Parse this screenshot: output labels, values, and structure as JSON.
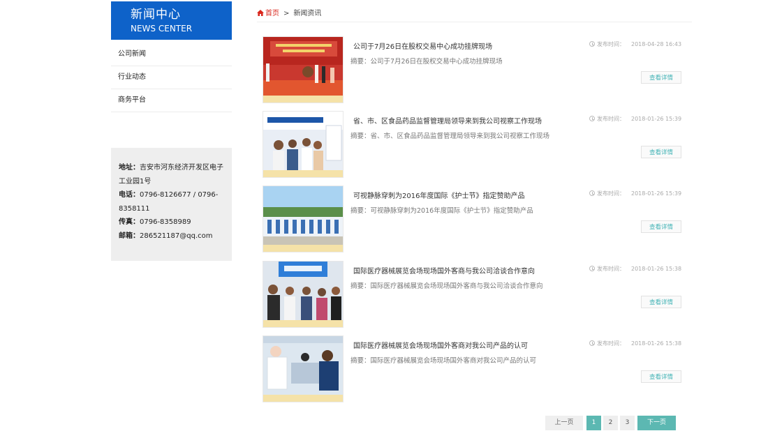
{
  "sidebar": {
    "title_cn": "新闻中心",
    "title_en": "NEWS CENTER",
    "nav": [
      "公司新闻",
      "行业动态",
      "商务平台"
    ],
    "contact": {
      "address_label": "地址：",
      "address": "吉安市河东经济开发区电子工业园1号",
      "phone_label": "电话：",
      "phone": "0796-8126677 / 0796-8358111",
      "fax_label": "传真：",
      "fax": "0796-8358989",
      "email_label": "邮箱：",
      "email": "286521187@qq.com"
    }
  },
  "breadcrumb": {
    "home": "首页",
    "separator": ">",
    "current": "新闻资讯"
  },
  "news": {
    "time_label": "发布时间：",
    "summary_label": "摘要：",
    "more_label": "查看详情",
    "items": [
      {
        "title": "公司于7月26日在股权交易中心成功挂牌现场",
        "time": "2018-04-28 16:43",
        "summary": "公司于7月26日在股权交易中心成功挂牌现场"
      },
      {
        "title": "省、市、区食品药品监督管理局领导来到我公司视察工作现场",
        "time": "2018-01-26 15:39",
        "summary": "省、市、区食品药品监督管理局领导来到我公司视察工作现场"
      },
      {
        "title": "可视静脉穿刺为2016年度国际《护士节》指定赞助产品",
        "time": "2018-01-26 15:39",
        "summary": "可视静脉穿刺为2016年度国际《护士节》指定赞助产品"
      },
      {
        "title": "国际医疗器械展览会场现场国外客商与我公司洽谈合作意向",
        "time": "2018-01-26 15:38",
        "summary": "国际医疗器械展览会场现场国外客商与我公司洽谈合作意向"
      },
      {
        "title": "国际医疗器械展览会场现场国外客商对我公司产品的认可",
        "time": "2018-01-26 15:38",
        "summary": "国际医疗器械展览会场现场国外客商对我公司产品的认可"
      }
    ]
  },
  "pagination": {
    "prev": "上一页",
    "pages": [
      "1",
      "2",
      "3"
    ],
    "active_page": "1",
    "next": "下一页"
  },
  "colors": {
    "brand_blue": "#0e62c9",
    "accent_teal": "#5cb8b2",
    "breadcrumb_home_red": "#d9261c"
  }
}
